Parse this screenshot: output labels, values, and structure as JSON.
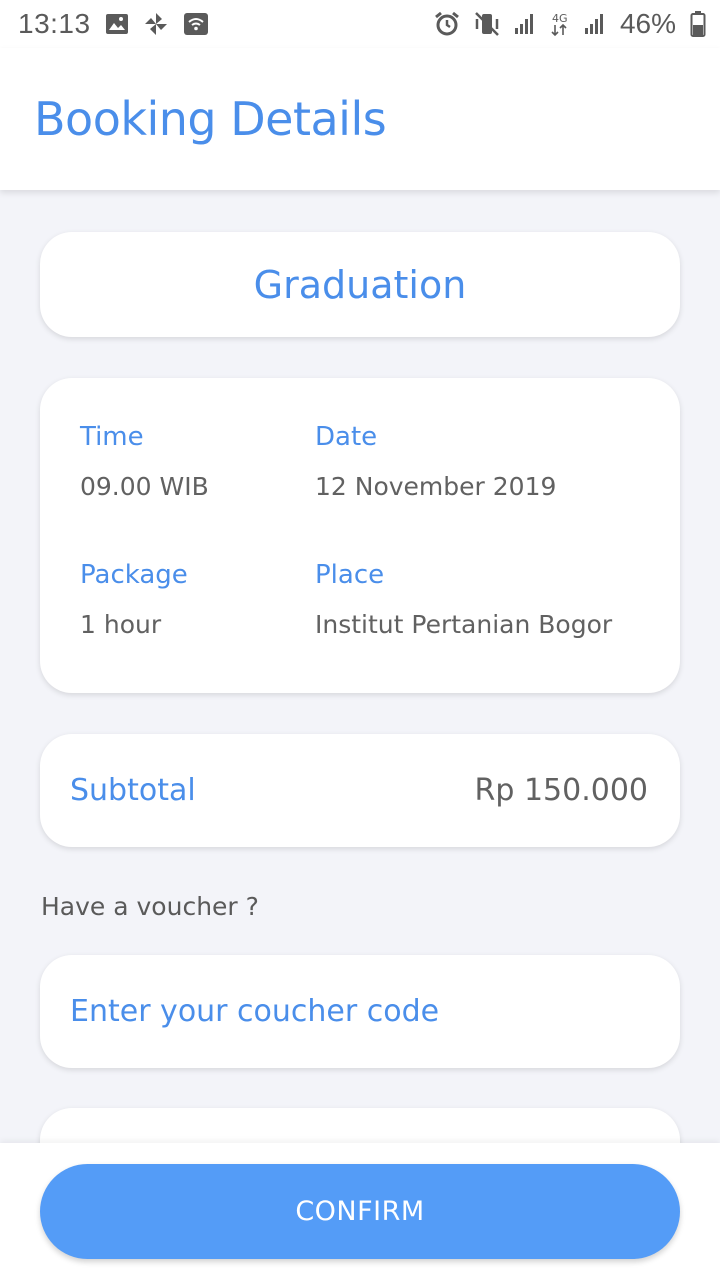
{
  "status_bar": {
    "time": "13:13",
    "battery": "46%",
    "network": "4G",
    "icons": [
      "image-icon",
      "pinwheel-icon",
      "wifi-hotspot-icon",
      "alarm-icon",
      "vibrate-icon",
      "signal-icon",
      "network-4g-icon",
      "signal-icon",
      "battery-icon"
    ]
  },
  "header": {
    "title": "Booking Details"
  },
  "event": {
    "title": "Graduation"
  },
  "details": {
    "time_label": "Time",
    "time_value": "09.00 WIB",
    "date_label": "Date",
    "date_value": "12 November 2019",
    "package_label": "Package",
    "package_value": "1 hour",
    "place_label": "Place",
    "place_value": "Institut Pertanian Bogor"
  },
  "subtotal": {
    "label": "Subtotal",
    "value": "Rp 150.000"
  },
  "voucher": {
    "question": "Have a voucher ?",
    "placeholder": "Enter your coucher code"
  },
  "actions": {
    "confirm_label": "CONFIRM"
  },
  "colors": {
    "accent": "#4a8eea",
    "button": "#549cf7",
    "background": "#f3f4f9",
    "text": "#616161"
  }
}
